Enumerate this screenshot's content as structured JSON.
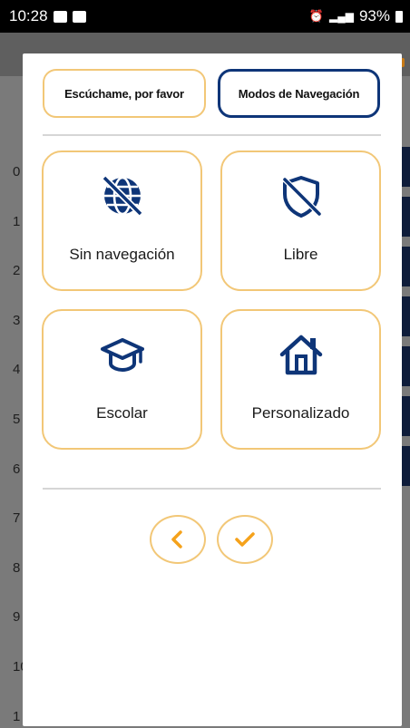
{
  "status_bar": {
    "time": "10:28",
    "battery": "93%"
  },
  "background": {
    "row_numbers": [
      "0",
      "1",
      "2",
      "3",
      "4",
      "5",
      "6",
      "7",
      "8",
      "9",
      "10",
      "1"
    ]
  },
  "modal": {
    "listen_button": "Escúchame, por favor",
    "modes_button": "Modos de Navegación",
    "modes": [
      {
        "label": "Sin navegación",
        "icon": "globe-slash-icon"
      },
      {
        "label": "Libre",
        "icon": "shield-slash-icon"
      },
      {
        "label": "Escolar",
        "icon": "graduation-cap-icon"
      },
      {
        "label": "Personalizado",
        "icon": "house-icon"
      }
    ],
    "back_icon": "chevron-left-icon",
    "confirm_icon": "check-icon"
  },
  "colors": {
    "brand_blue": "#0e3578",
    "accent_orange": "#f5a21b",
    "card_border": "#f2c777"
  }
}
